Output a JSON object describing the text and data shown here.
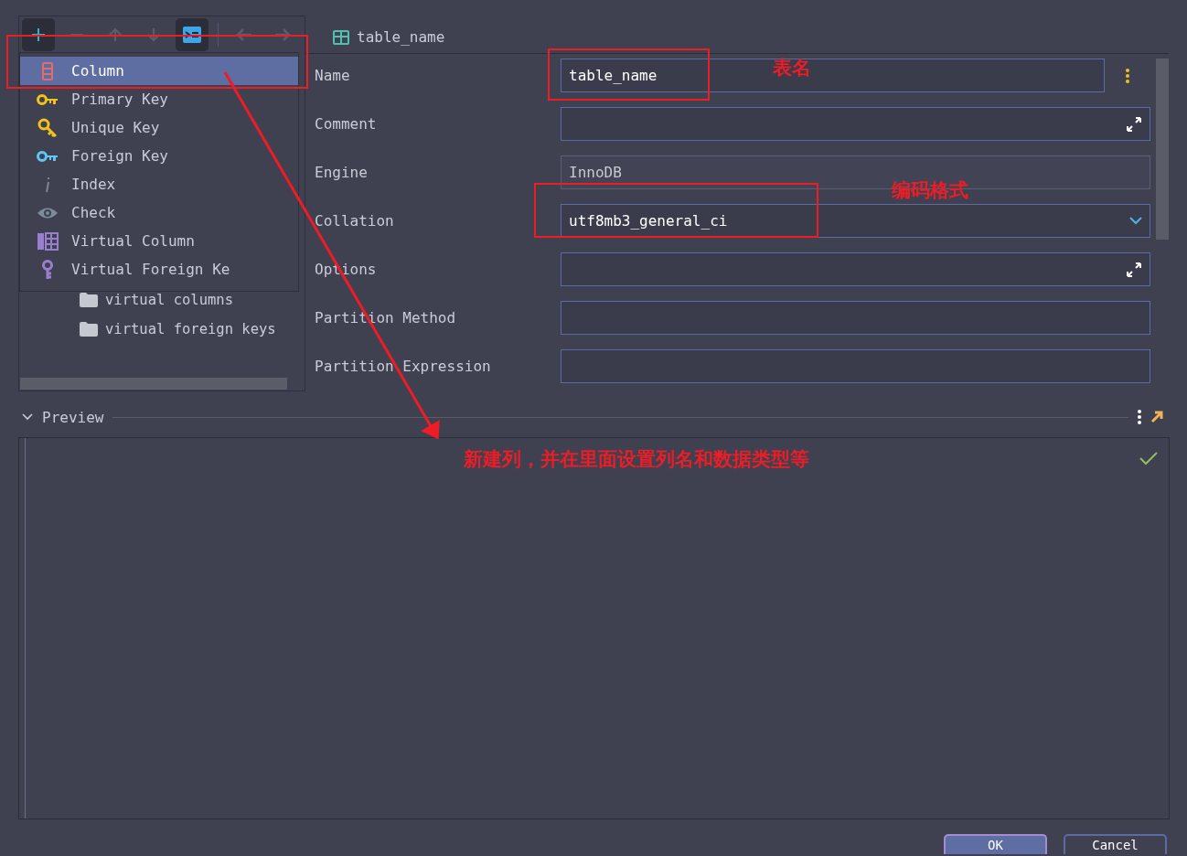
{
  "toolbar": {
    "groups": [
      [
        {
          "kind": "add",
          "highlighted": true,
          "disabled": false
        },
        {
          "kind": "remove",
          "highlighted": false,
          "disabled": true
        },
        {
          "kind": "up",
          "highlighted": false,
          "disabled": true
        },
        {
          "kind": "down",
          "highlighted": false,
          "disabled": true
        },
        {
          "kind": "ddl",
          "highlighted": true,
          "disabled": false
        }
      ],
      [
        {
          "kind": "back",
          "highlighted": false,
          "disabled": true
        },
        {
          "kind": "forward",
          "highlighted": false,
          "disabled": true
        }
      ]
    ]
  },
  "menu": {
    "items": [
      {
        "label": "Column",
        "kind": "column",
        "selected": true
      },
      {
        "label": "Primary Key",
        "kind": "primary_key",
        "selected": false
      },
      {
        "label": "Unique Key",
        "kind": "unique_key",
        "selected": false
      },
      {
        "label": "Foreign Key",
        "kind": "foreign_key",
        "selected": false
      },
      {
        "label": "Index",
        "kind": "index",
        "selected": false
      },
      {
        "label": "Check",
        "kind": "check",
        "selected": false
      },
      {
        "label": "Virtual Column",
        "kind": "virtual_column",
        "selected": false
      },
      {
        "label": "Virtual Foreign Ke",
        "kind": "virtual_foreign_key",
        "selected": false
      }
    ]
  },
  "tree": {
    "items": [
      {
        "label": "virtual columns"
      },
      {
        "label": "virtual foreign keys"
      }
    ]
  },
  "tab": {
    "label": "table_name"
  },
  "fields": [
    {
      "label": "Name",
      "value": "table_name",
      "kind": "text",
      "menu": true
    },
    {
      "label": "Comment",
      "kind": "expandable",
      "menu": false
    },
    {
      "label": "Engine",
      "value": "InnoDB",
      "kind": "readonly",
      "menu": false
    },
    {
      "label": "Collation",
      "value": "utf8mb3_general_ci",
      "kind": "dropdown",
      "menu": false
    },
    {
      "label": "Options",
      "kind": "expandable",
      "menu": false
    },
    {
      "label": "Partition Method",
      "kind": "text",
      "menu": false
    },
    {
      "label": "Partition Expression",
      "kind": "text",
      "menu": false
    }
  ],
  "preview": {
    "title": "Preview",
    "expanded": true,
    "valid": true
  },
  "buttons": [
    {
      "label": "OK",
      "default": true
    },
    {
      "label": "Cancel",
      "default": false
    }
  ],
  "annotations": [
    {
      "kind": "name_note",
      "text": "表名"
    },
    {
      "kind": "collation_note",
      "text": "编码格式"
    },
    {
      "kind": "column_note",
      "text": "新建列，并在里面设置列名和数据类型等"
    }
  ]
}
